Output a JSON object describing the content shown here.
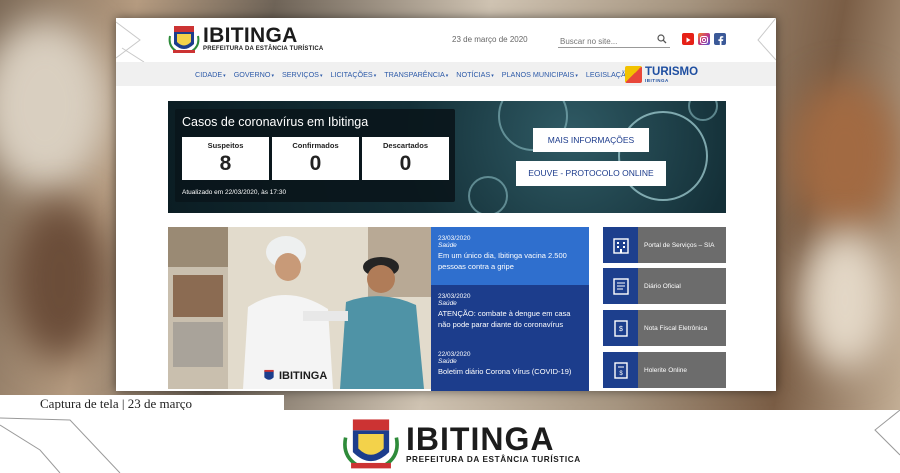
{
  "site": {
    "logo": {
      "name": "IBITINGA",
      "subtitle": "PREFEITURA DA ESTÂNCIA TURÍSTICA"
    },
    "date": "23 de março de 2020",
    "search": {
      "placeholder": "Buscar no site..."
    },
    "social": [
      {
        "icon": "youtube-icon",
        "color": "#e62117"
      },
      {
        "icon": "instagram-icon",
        "color": "#c13584"
      },
      {
        "icon": "facebook-icon",
        "color": "#3b5998"
      }
    ]
  },
  "nav": {
    "items": [
      "CIDADE",
      "GOVERNO",
      "SERVIÇOS",
      "LICITAÇÕES",
      "TRANSPARÊNCIA",
      "NOTÍCIAS",
      "PLANOS MUNICIPAIS",
      "LEGISLAÇÃO"
    ],
    "turismo": {
      "name": "TURISMO",
      "sub": "IBITINGA"
    }
  },
  "covid": {
    "title": "Casos de coronavírus em Ibitinga",
    "stats": [
      {
        "label": "Suspeitos",
        "value": "8"
      },
      {
        "label": "Confirmados",
        "value": "0"
      },
      {
        "label": "Descartados",
        "value": "0"
      }
    ],
    "updated": "Atualizado em 22/03/2020, às 17:30",
    "buttons": [
      "MAIS INFORMAÇÕES",
      "EOUVE - PROTOCOLO ONLINE"
    ]
  },
  "news": {
    "photo_logo": "IBITINGA",
    "items": [
      {
        "date": "23/03/2020",
        "category": "Saúde",
        "title": "Em um único dia, Ibitinga vacina 2.500 pessoas contra a gripe",
        "active": true
      },
      {
        "date": "23/03/2020",
        "category": "Saúde",
        "title": "ATENÇÃO: combate à dengue em casa não pode parar diante do coronavírus",
        "active": false
      },
      {
        "date": "22/03/2020",
        "category": "Saúde",
        "title": "Boletim diário Corona Vírus (COVID-19)",
        "active": false
      }
    ]
  },
  "services": [
    {
      "label": "Portal de Serviços – SIA",
      "icon": "building-icon"
    },
    {
      "label": "Diário Oficial",
      "icon": "newspaper-icon"
    },
    {
      "label": "Nota Fiscal Eletrônica",
      "icon": "invoice-icon"
    },
    {
      "label": "Holerite Online",
      "icon": "payslip-icon"
    }
  ],
  "caption": "Captura de tela | 23 de março",
  "footer": {
    "name": "IBITINGA",
    "subtitle": "PREFEITURA DA ESTÂNCIA TURÍSTICA"
  },
  "colors": {
    "navy": "#1c3d8c",
    "active_news": "#2f6fce",
    "nav_link": "#2d5aa8",
    "service_gray": "#6c6c6c"
  }
}
